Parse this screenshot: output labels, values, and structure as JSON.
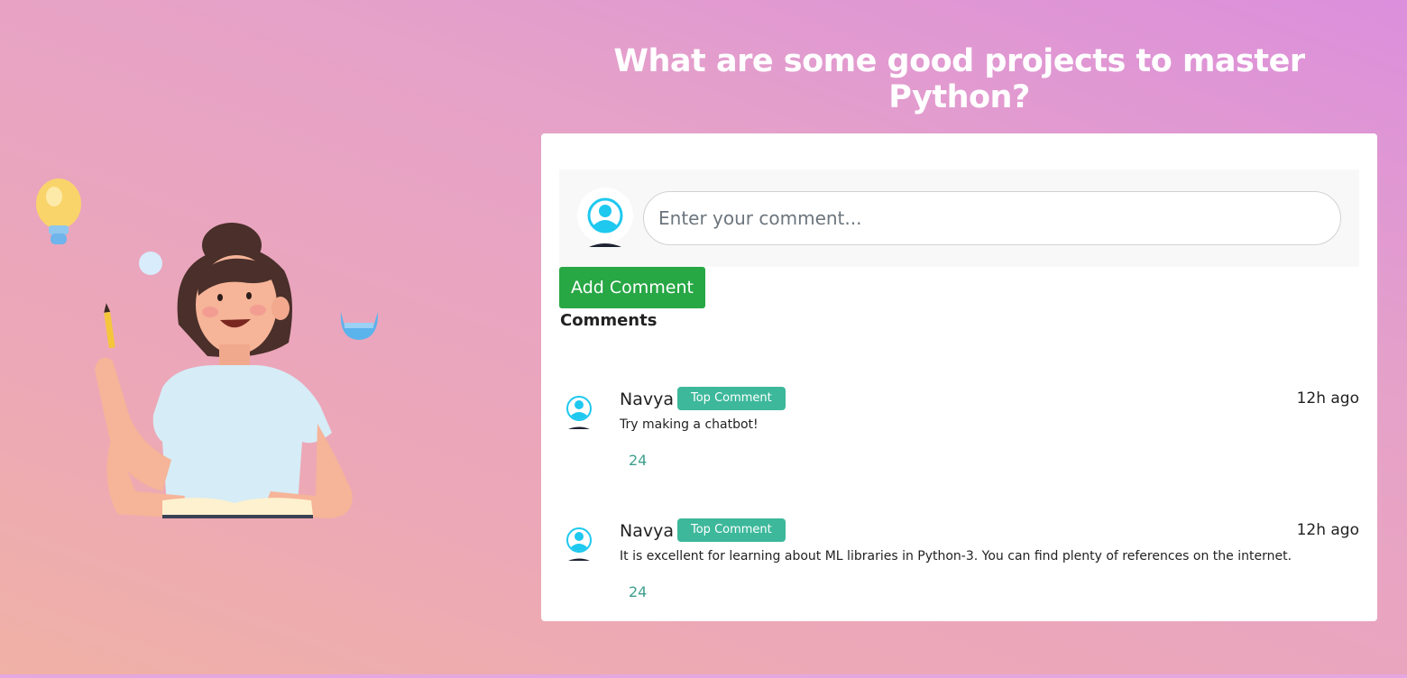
{
  "page": {
    "title": "What are some good projects to master Python?"
  },
  "composer": {
    "placeholder": "Enter your comment...",
    "value": "",
    "add_label": "Add Comment"
  },
  "comments_section": {
    "heading": "Comments",
    "items": [
      {
        "author": "Navya",
        "badge": "Top Comment",
        "time": "12h ago",
        "text": "Try making a chatbot!",
        "likes": "24"
      },
      {
        "author": "Navya",
        "badge": "Top Comment",
        "time": "12h ago",
        "text": "It is excellent for learning about ML libraries in Python-3. You can find plenty of references on the internet.",
        "likes": "24"
      }
    ]
  },
  "colors": {
    "button_green": "#28a745",
    "badge_teal": "#3db89b",
    "like_teal": "#3e9f8d",
    "title_white": "#ffffff",
    "avatar_cyan": "#1ec8ef"
  },
  "icons": {
    "composer_avatar": "user-avatar-icon",
    "comment_avatar": "user-avatar-icon"
  }
}
